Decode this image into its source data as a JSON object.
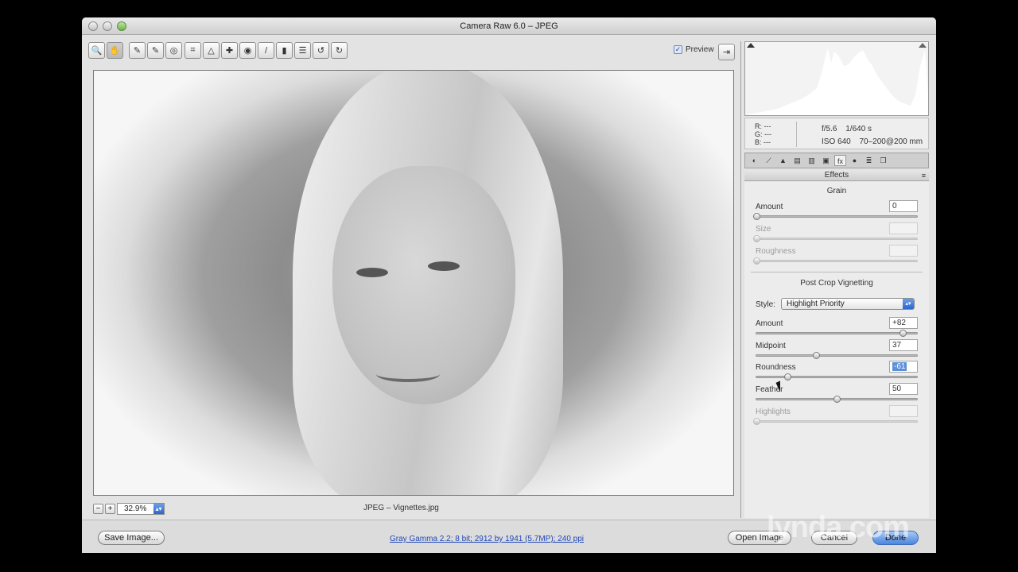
{
  "window": {
    "title": "Camera Raw 6.0  –  JPEG"
  },
  "toolbar": {
    "tools": [
      {
        "name": "zoom-tool",
        "glyph": "🔍"
      },
      {
        "name": "hand-tool",
        "glyph": "✋"
      },
      {
        "name": "white-balance-tool",
        "glyph": "✎"
      },
      {
        "name": "color-sampler-tool",
        "glyph": "✎"
      },
      {
        "name": "targeted-adjustment-tool",
        "glyph": "◎"
      },
      {
        "name": "crop-tool",
        "glyph": "⌗"
      },
      {
        "name": "straighten-tool",
        "glyph": "△"
      },
      {
        "name": "spot-removal-tool",
        "glyph": "✚"
      },
      {
        "name": "red-eye-tool",
        "glyph": "◉"
      },
      {
        "name": "adjustment-brush-tool",
        "glyph": "/"
      },
      {
        "name": "graduated-filter-tool",
        "glyph": "▮"
      },
      {
        "name": "preferences-tool",
        "glyph": "☰"
      },
      {
        "name": "rotate-left-tool",
        "glyph": "↺"
      },
      {
        "name": "rotate-right-tool",
        "glyph": "↻"
      }
    ],
    "preview_label": "Preview",
    "preview_checked": true
  },
  "status": {
    "zoom_minus": "−",
    "zoom_plus": "+",
    "zoom_value": "32.9%",
    "filename": "JPEG  –  Vignettes.jpg"
  },
  "info": {
    "r_label": "R:",
    "r_value": "---",
    "g_label": "G:",
    "g_value": "---",
    "b_label": "B:",
    "b_value": "---",
    "aperture": "f/5.6",
    "shutter": "1/640 s",
    "iso": "ISO 640",
    "lens": "70–200@200 mm"
  },
  "panel": {
    "header": "Effects",
    "grain": {
      "title": "Grain",
      "amount": {
        "label": "Amount",
        "value": "0",
        "pos": 0.0
      },
      "size": {
        "label": "Size",
        "value": "",
        "pos": 0.0
      },
      "roughness": {
        "label": "Roughness",
        "value": "",
        "pos": 0.0
      }
    },
    "vignette": {
      "title": "Post Crop Vignetting",
      "style_label": "Style:",
      "style_value": "Highlight Priority",
      "amount": {
        "label": "Amount",
        "value": "+82",
        "pos": 0.91
      },
      "midpoint": {
        "label": "Midpoint",
        "value": "37",
        "pos": 0.37
      },
      "roundness": {
        "label": "Roundness",
        "value": "-61",
        "pos": 0.195
      },
      "feather": {
        "label": "Feather",
        "value": "50",
        "pos": 0.5
      },
      "highlights": {
        "label": "Highlights",
        "value": "",
        "pos": 0.0
      }
    }
  },
  "buttons": {
    "save": "Save Image...",
    "workflow": "Gray Gamma 2.2; 8 bit; 2912 by 1941 (5.7MP); 240 ppi",
    "open": "Open Image",
    "cancel": "Cancel",
    "done": "Done"
  },
  "watermark": "lynda.com"
}
